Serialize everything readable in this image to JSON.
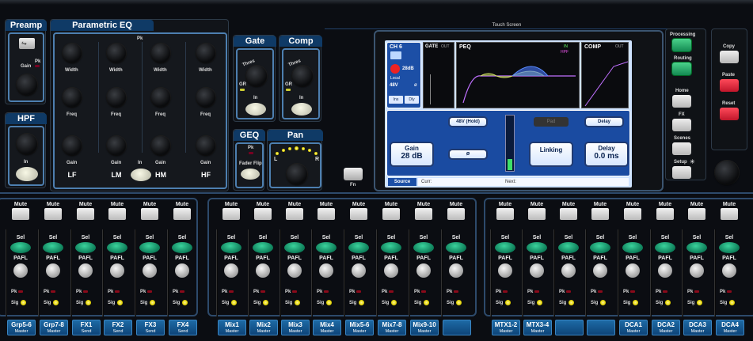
{
  "top_strip": {
    "touch_screen": "Touch Screen"
  },
  "preamp": {
    "title": "Preamp",
    "gain": "Gain",
    "pk": "Pk"
  },
  "hpf": {
    "title": "HPF",
    "in": "In"
  },
  "peq": {
    "title": "Parametric EQ",
    "pk": "Pk",
    "width": "Width",
    "freq": "Freq",
    "gain": "Gain",
    "in": "In",
    "bands": [
      "LF",
      "LM",
      "HM",
      "HF"
    ]
  },
  "gate": {
    "title": "Gate",
    "thres": "Thres",
    "gr": "GR",
    "in": "In"
  },
  "comp": {
    "title": "Comp",
    "thres": "Thres",
    "gr": "GR",
    "in": "In"
  },
  "geq": {
    "title": "GEQ",
    "pk": "Pk",
    "fader_flip": "Fader Flip"
  },
  "pan": {
    "title": "Pan",
    "l": "L",
    "r": "R"
  },
  "screen": {
    "channel": "CH 6",
    "gain_small": "28dB",
    "local": "Local",
    "phantom_small": "48V",
    "polarity_small": "ø",
    "ins": "Ins",
    "dly": "Dly",
    "gate": "GATE",
    "out": "OUT",
    "peq": "PEQ",
    "in": "IN",
    "hpf": "HPF",
    "comp": "COMP",
    "comp_out": "OUT",
    "btn_48v": "48V (Hold)",
    "btn_polarity": "ø",
    "btn_pad": "Pad",
    "btn_delay": "Delay",
    "gain_label": "Gain",
    "gain_value": "28 dB",
    "linking": "Linking",
    "delay_label": "Delay",
    "delay_value": "0.0 ms",
    "source": "Source",
    "curr": "Curr:",
    "next": "Next: "
  },
  "fn": "Fn",
  "right_panel": {
    "processing": "Processing",
    "routing": "Routing",
    "home": "Home",
    "fx": "FX",
    "scenes": "Scenes",
    "setup": "Setup",
    "copy": "Copy",
    "paste": "Paste",
    "reset": "Reset"
  },
  "strip_labels": {
    "mute": "Mute",
    "sel": "Sel",
    "pafl": "PAFL",
    "pk": "Pk",
    "sig": "Sig"
  },
  "strips": [
    {
      "name": "Grp5-6",
      "sub": "Master"
    },
    {
      "name": "Grp7-8",
      "sub": "Master"
    },
    {
      "name": "FX1",
      "sub": "Send"
    },
    {
      "name": "FX2",
      "sub": "Send"
    },
    {
      "name": "FX3",
      "sub": "Send"
    },
    {
      "name": "FX4",
      "sub": "Send"
    },
    {
      "name": "Mix1",
      "sub": "Master"
    },
    {
      "name": "Mix2",
      "sub": "Master"
    },
    {
      "name": "Mix3",
      "sub": "Master"
    },
    {
      "name": "Mix4",
      "sub": "Master"
    },
    {
      "name": "Mix5-6",
      "sub": "Master"
    },
    {
      "name": "Mix7-8",
      "sub": "Master"
    },
    {
      "name": "Mix9-10",
      "sub": "Master"
    },
    {
      "name": "",
      "sub": ""
    },
    {
      "name": "MTX1-2",
      "sub": "Master"
    },
    {
      "name": "MTX3-4",
      "sub": "Master"
    },
    {
      "name": "",
      "sub": ""
    },
    {
      "name": "",
      "sub": ""
    },
    {
      "name": "DCA1",
      "sub": "Master"
    },
    {
      "name": "DCA2",
      "sub": "Master"
    },
    {
      "name": "DCA3",
      "sub": "Master"
    },
    {
      "name": "DCA4",
      "sub": "Master"
    }
  ]
}
